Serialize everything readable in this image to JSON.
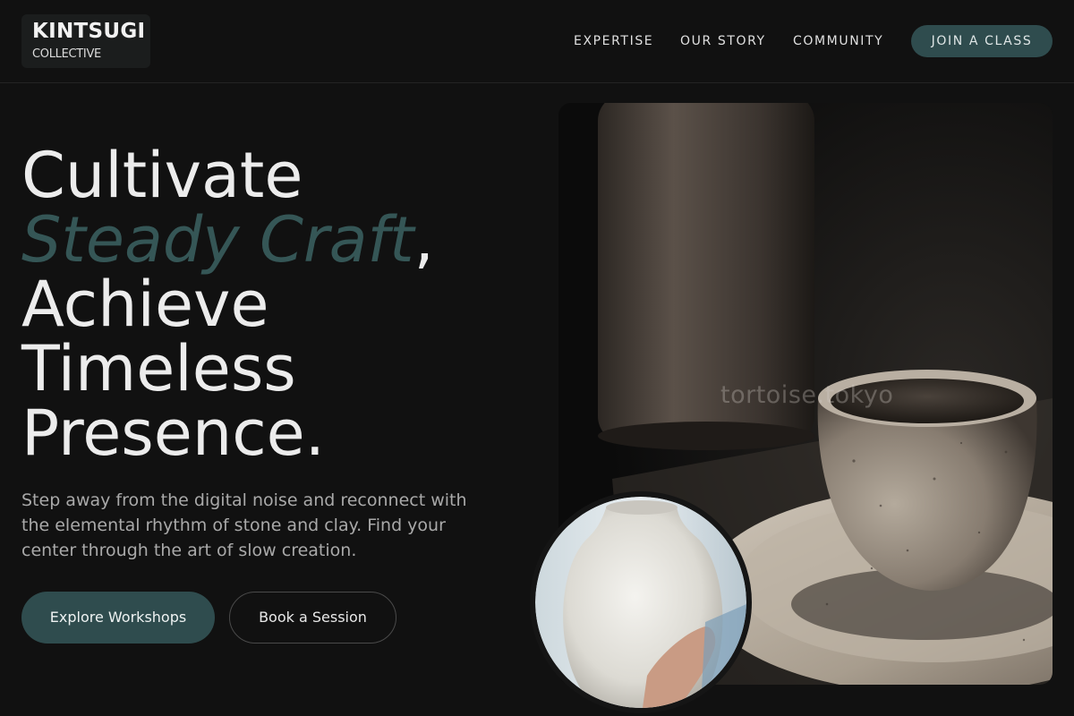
{
  "brand": {
    "name": "KINTSUGI",
    "tagline": "COLLECTIVE"
  },
  "nav": {
    "items": [
      "EXPERTISE",
      "OUR STORY",
      "COMMUNITY"
    ],
    "cta": "JOIN A CLASS"
  },
  "hero": {
    "line1": "Cultivate",
    "accent": "Steady Craft",
    "comma": ",",
    "line3": "Achieve",
    "line4": "Timeless",
    "line5": "Presence.",
    "description": "Step away from the digital noise and reconnect with the elemental rhythm of stone and clay. Find your center through the art of slow creation.",
    "primary_button": "Explore Workshops",
    "secondary_button": "Book a Session"
  },
  "media": {
    "watermark": "tortoise.tokyo"
  },
  "colors": {
    "background": "#111111",
    "accent": "#2f4c4e",
    "accent_text": "#355656"
  }
}
